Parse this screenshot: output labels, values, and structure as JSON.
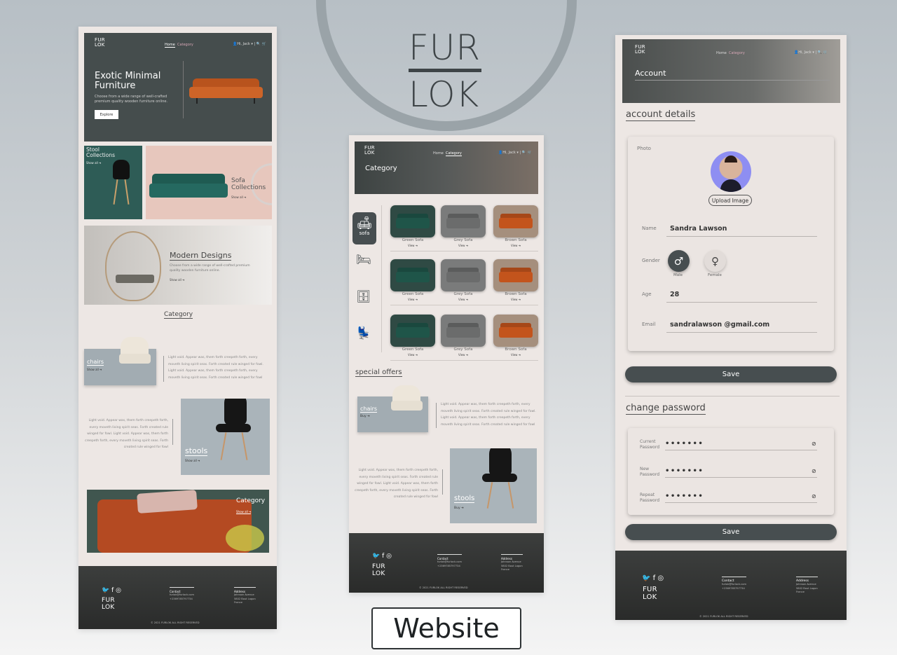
{
  "brand": {
    "line1": "FUR",
    "line2": "LOK"
  },
  "caption": "Website",
  "nav": {
    "home": "Home",
    "category": "Category",
    "user": "Hi, Jack",
    "logo1": "FUR",
    "logo2": "LOK"
  },
  "home": {
    "hero_title1": "Exotic Minimal",
    "hero_title2": "Furniture",
    "hero_text": "Choose from a wide range of well-crafted premium quality wooden furniture online.",
    "explore": "Explore",
    "stool_title1": "Stool",
    "stool_title2": "Collections",
    "show_all": "Show all",
    "sofa_title1": "Sofa",
    "sofa_title2": "Collections",
    "modern_title": "Modern Designs",
    "modern_text": "Choose from a wide range of well-crafted premium quality wooden furniture online.",
    "category_heading": "Category",
    "chairs": "chairs",
    "stools": "stools",
    "category_label": "Category",
    "lorem": "Light void. Appear was, them forth creepeth forth, every moveth living spirit seas. Forth created rule winged for fowl. Light void. Appear was, them forth creepeth forth, every moveth living spirit seas. Forth created rule winged for fowl"
  },
  "category_page": {
    "banner": "Category",
    "sofa_tab": "sofa",
    "products": [
      {
        "name": "Green Sofa",
        "action": "View"
      },
      {
        "name": "Grey Sofa",
        "action": "View"
      },
      {
        "name": "Brown Sofa",
        "action": "View"
      }
    ],
    "special_offers": "special offers",
    "chairs": "chairs",
    "stools": "stools",
    "buy": "Buy"
  },
  "footer": {
    "contact": "Contact",
    "contact_lines": [
      "furlok@furlock.com",
      "+2369785797734"
    ],
    "address": "Address",
    "address_lines": [
      "Johnson Avenue",
      "5802 Bout Lagon",
      "France"
    ],
    "copyright": "© 2021 FURLOK ALL RIGHT RESERVED"
  },
  "account": {
    "banner": "Account",
    "details_heading": "account details",
    "photo_label": "Photo",
    "upload": "Upload Image",
    "name_label": "Name",
    "name": "Sandra Lawson",
    "gender_label": "Gender",
    "male": "Male",
    "female": "Female",
    "age_label": "Age",
    "age": "28",
    "email_label": "Email",
    "email": "sandralawson @gmail.com",
    "save": "Save",
    "password_heading": "change password",
    "current_l1": "Current",
    "current_l2": "Password",
    "new_l1": "New",
    "new_l2": "Password",
    "repeat_l1": "Repeat",
    "repeat_l2": "Password",
    "masked": "•••••••"
  },
  "colors": {
    "accent": "#474e50",
    "panel": "#ede7e4",
    "teal": "#2f5a55",
    "pink": "#e7c7bd",
    "orange": "#c8591f"
  }
}
